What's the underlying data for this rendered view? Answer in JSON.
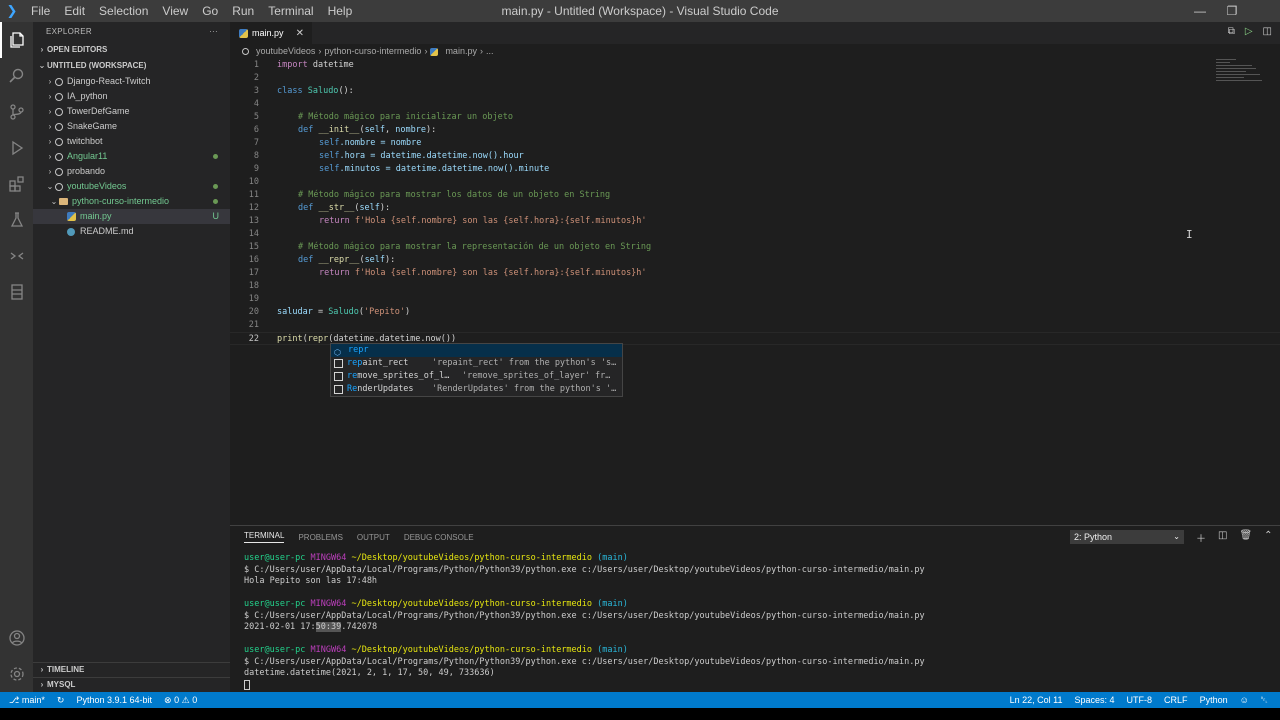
{
  "titlebar": {
    "title": "main.py - Untitled (Workspace) - Visual Studio Code",
    "menu": [
      "File",
      "Edit",
      "Selection",
      "View",
      "Go",
      "Run",
      "Terminal",
      "Help"
    ]
  },
  "sidebar": {
    "title": "EXPLORER",
    "more": "···",
    "open_editors": "OPEN EDITORS",
    "workspace": "UNTITLED (WORKSPACE)",
    "items": [
      {
        "label": "Django-React-Twitch"
      },
      {
        "label": "IA_python"
      },
      {
        "label": "TowerDefGame"
      },
      {
        "label": "SnakeGame"
      },
      {
        "label": "twitchbot"
      },
      {
        "label": "Angular11"
      },
      {
        "label": "probando"
      },
      {
        "label": "youtubeVideos"
      },
      {
        "label": "python-curso-intermedio"
      },
      {
        "label": "main.py",
        "badge": "U"
      },
      {
        "label": "README.md"
      }
    ],
    "timeline": "TIMELINE",
    "mysql": "MYSQL"
  },
  "editor": {
    "tab_label": "main.py",
    "breadcrumb": [
      "youtubeVideos",
      "python-curso-intermedio",
      "main.py",
      "..."
    ],
    "line_numbers": [
      "1",
      "2",
      "3",
      "4",
      "5",
      "6",
      "7",
      "8",
      "9",
      "10",
      "11",
      "12",
      "13",
      "14",
      "15",
      "16",
      "17",
      "18",
      "19",
      "20",
      "21",
      "22"
    ],
    "code": {
      "l1a": "import",
      "l1b": " datetime",
      "l3a": "class",
      "l3b": "Saludo",
      "l3c": "():",
      "l5": "# Método mágico para inicializar un objeto",
      "l6a": "def",
      "l6b": "__init__",
      "l6c": "(",
      "l6d": "self",
      "l6e": ", ",
      "l6f": "nombre",
      "l6g": "):",
      "l7a": "self",
      "l7b": ".nombre = nombre",
      "l8a": "self",
      "l8b": ".hora = datetime.datetime.now().hour",
      "l9a": "self",
      "l9b": ".minutos = datetime.datetime.now().minute",
      "l11": "# Método mágico para mostrar los datos de un objeto en String",
      "l12a": "def",
      "l12b": "__str__",
      "l12c": "(",
      "l12d": "self",
      "l12e": "):",
      "l13a": "return",
      "l13b": "f'Hola {self.nombre} son las {self.hora}:{self.minutos}h'",
      "l15": "# Método mágico para mostrar la representación de un objeto en String",
      "l16a": "def",
      "l16b": "__repr__",
      "l16c": "(",
      "l16d": "self",
      "l16e": "):",
      "l17a": "return",
      "l17b": "f'Hola {self.nombre} son las {self.hora}:{self.minutos}h'",
      "l20a": "saludar",
      "l20b": " = ",
      "l20c": "Saludo",
      "l20d": "(",
      "l20e": "'Pepito'",
      "l20f": ")",
      "l22a": "print",
      "l22b": "(",
      "l22c": "repr",
      "l22d": "(datetime.datetime.now())"
    },
    "cursor_glyph": "I"
  },
  "suggest": {
    "items": [
      {
        "hl": "repr",
        "rest": "",
        "detail": ""
      },
      {
        "hl": "rep",
        "rest": "aint_rect",
        "detail": "'repaint_rect' from the python's 's…"
      },
      {
        "hl": "re",
        "rest": "move_sprites_of_l…",
        "detail": "'remove_sprites_of_layer' fr…"
      },
      {
        "hl": "Re",
        "rest": "nderUpdates",
        "detail": "'RenderUpdates' from the python's '…"
      }
    ]
  },
  "panel": {
    "tabs": [
      "TERMINAL",
      "PROBLEMS",
      "OUTPUT",
      "DEBUG CONSOLE"
    ],
    "terminal_select": "2: Python",
    "prompt_user": "user@user-pc",
    "prompt_env": "MINGW64",
    "prompt_path": "~/Desktop/youtubeVideos/python-curso-intermedio",
    "prompt_branch": "(main)",
    "command": "$ C:/Users/user/AppData/Local/Programs/Python/Python39/python.exe c:/Users/user/Desktop/youtubeVideos/python-curso-intermedio/main.py",
    "out1": "Hola Pepito son las 17:48h",
    "out2a": "2021-02-01 17:",
    "out2b": "50:39",
    "out2c": ".742078",
    "out3": "datetime.datetime(2021, 2, 1, 17, 50, 49, 733636)"
  },
  "statusbar": {
    "branch": "main*",
    "python": "Python 3.9.1 64-bit",
    "errors": "0",
    "warnings": "0",
    "position": "Ln 22, Col 11",
    "spaces": "Spaces: 4",
    "encoding": "UTF-8",
    "eol": "CRLF",
    "language": "Python"
  }
}
